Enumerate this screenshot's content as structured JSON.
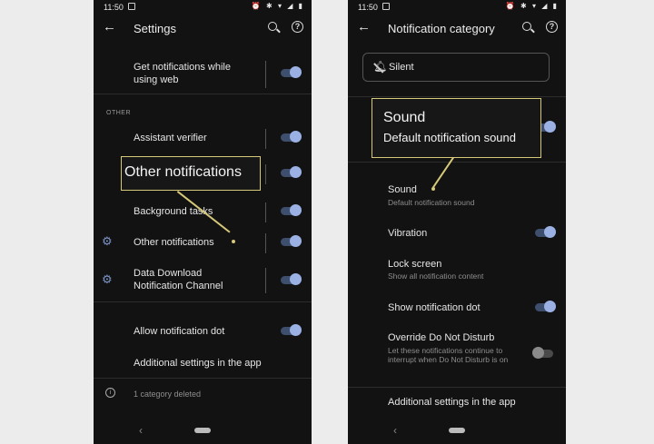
{
  "left_screen": {
    "status_time": "11:50",
    "status_icons": "⏰ ✱ ▾ ◢ ▮",
    "title": "Settings",
    "rows": {
      "get_web": {
        "label": "Get notifications while using web",
        "toggle_on": true
      },
      "section_other": "OTHER",
      "assistant_verifier": {
        "label": "Assistant verifier",
        "toggle_on": true
      },
      "hidden_row": {
        "toggle_on": true
      },
      "background_tasks": {
        "label": "Background tasks",
        "toggle_on": true
      },
      "other_notifications": {
        "label": "Other notifications",
        "icon": "gear-icon",
        "toggle_on": true
      },
      "data_download": {
        "label": "Data Download Notification Channel",
        "icon": "gear-icon",
        "toggle_on": true
      },
      "allow_dot": {
        "label": "Allow notification dot",
        "toggle_on": true
      },
      "additional": {
        "label": "Additional settings in the app"
      },
      "deleted": {
        "label": "1 category deleted",
        "icon": "info-icon"
      }
    },
    "callout": "Other notifications"
  },
  "right_screen": {
    "status_time": "11:50",
    "status_icons": "⏰ ✱ ▾ ◢ ▮",
    "title": "Notification category",
    "silent_label": "Silent",
    "rows": {
      "sound": {
        "label": "Sound",
        "sub": "Default notification sound"
      },
      "vibration": {
        "label": "Vibration",
        "toggle_on": true
      },
      "lock_screen": {
        "label": "Lock screen",
        "sub": "Show all notification content"
      },
      "show_dot": {
        "label": "Show notification dot",
        "toggle_on": true
      },
      "override_dnd": {
        "label": "Override Do Not Disturb",
        "sub": "Let these notifications continue to interrupt when Do Not Disturb is on",
        "toggle_on": false
      },
      "additional": {
        "label": "Additional settings in the app"
      }
    },
    "callout": {
      "title": "Sound",
      "sub": "Default notification sound"
    }
  },
  "colors": {
    "background": "#121212",
    "accent_toggle": "#9bb1e4",
    "callout_border": "#d5c878"
  }
}
